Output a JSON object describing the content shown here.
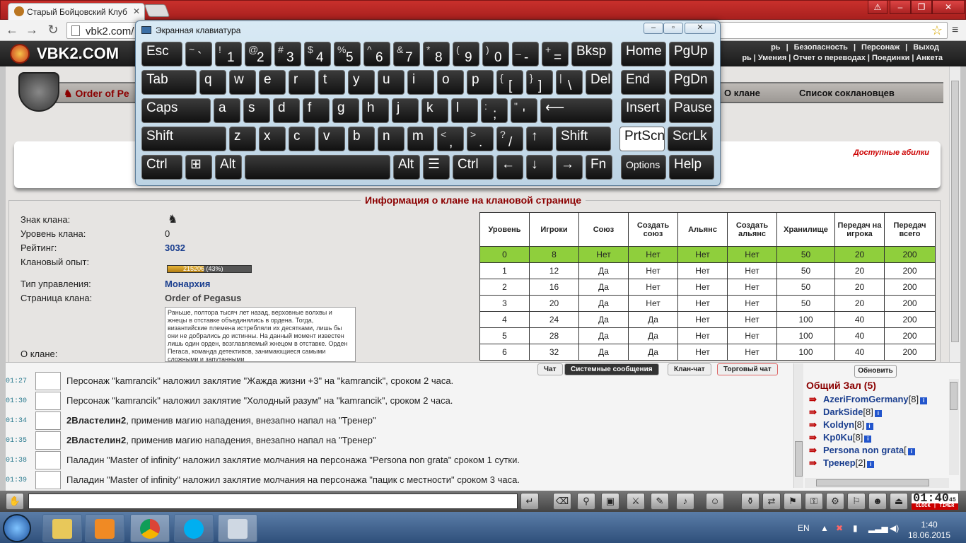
{
  "browser": {
    "tab_title": "Старый Бойцовский Клуб",
    "url": "vbk2.com/",
    "window_controls": [
      "⚠",
      "–",
      "❐",
      "✕"
    ]
  },
  "game": {
    "logo": "VBK2.COM",
    "topnav": [
      "рь",
      "Безопасность",
      "Персонаж",
      "Выход"
    ],
    "subnav": [
      "рь",
      "Умения",
      "Отчет о переводах",
      "Поединки",
      "Анкета"
    ]
  },
  "clan_page": {
    "order_link": "Order of Pe",
    "about_link": "О клане",
    "members_link": "Список соклановцев",
    "abilities_link": "Доступные абилки",
    "info_title": "Информация о клане на клановой странице",
    "fields": {
      "sign_label": "Знак клана:",
      "level_label": "Уровень клана:",
      "level_value": "0",
      "rating_label": "Рейтинг:",
      "rating_value": "3032",
      "xp_label": "Клановый опыт:",
      "xp_value": "215206 (43%)",
      "xp_fraction": 0.43,
      "gov_label": "Тип управления:",
      "gov_value": "Монархия",
      "page_label": "Страница клана:",
      "page_value": "Order of Pegasus",
      "about_label": "О клане:",
      "about_text": "Раньше, полтора тысяч лет назад, верховные волхвы и жнецы в отставке объединялись в ордена. Тогда, византийские племена истребляли их десятками, лишь бы они не добрались до истинны. На данный момент известен лишь один орден, возглавляемый жнецом в отставке. Орден Пегаса, команда детективов, занимающиеся самыми сложными и запутанными"
    },
    "table": {
      "headers": [
        "Уровень",
        "Игроки",
        "Союз",
        "Создать союз",
        "Альянс",
        "Создать альянс",
        "Хранилище",
        "Передач на игрока",
        "Передач всего"
      ],
      "rows": [
        [
          "0",
          "8",
          "Нет",
          "Нет",
          "Нет",
          "Нет",
          "50",
          "20",
          "200"
        ],
        [
          "1",
          "12",
          "Да",
          "Нет",
          "Нет",
          "Нет",
          "50",
          "20",
          "200"
        ],
        [
          "2",
          "16",
          "Да",
          "Нет",
          "Нет",
          "Нет",
          "50",
          "20",
          "200"
        ],
        [
          "3",
          "20",
          "Да",
          "Нет",
          "Нет",
          "Нет",
          "50",
          "20",
          "200"
        ],
        [
          "4",
          "24",
          "Да",
          "Да",
          "Нет",
          "Нет",
          "100",
          "40",
          "200"
        ],
        [
          "5",
          "28",
          "Да",
          "Да",
          "Нет",
          "Нет",
          "100",
          "40",
          "200"
        ],
        [
          "6",
          "32",
          "Да",
          "Да",
          "Нет",
          "Нет",
          "100",
          "40",
          "200"
        ]
      ]
    }
  },
  "chat": {
    "tabs": [
      "Чат",
      "Системные сообщения",
      "Клан-чат",
      "Торговый чат"
    ],
    "messages": [
      {
        "time": "01:27",
        "text": "Персонаж \"kamrancik\" наложил заклятие \"Жажда жизни +3\" на \"kamrancik\", сроком 2 часа."
      },
      {
        "time": "01:30",
        "text": "Персонаж \"kamrancik\" наложил заклятие \"Холодный разум\" на \"kamrancik\", сроком 2 часа."
      },
      {
        "time": "01:34",
        "bold": "2Властелин2",
        "text": ", применив магию нападения, внезапно напал на \"Тренер\""
      },
      {
        "time": "01:35",
        "bold": "2Властелин2",
        "text": ", применив магию нападения, внезапно напал на \"Тренер\""
      },
      {
        "time": "01:38",
        "text": "Паладин \"Master of infinity\" наложил заклятие молчания на персонажа \"Persona non grata\" сроком 1 сутки."
      },
      {
        "time": "01:39",
        "text": "Паладин \"Master of infinity\" наложил заклятие молчания на персонажа \"пацик с местности\" сроком 3 часа."
      }
    ],
    "refresh_label": "Обновить",
    "hall_title": "Общий Зал (5)",
    "users": [
      {
        "name": "AzeriFromGermany",
        "level": "[8]"
      },
      {
        "name": "DarkSide",
        "level": "[8]"
      },
      {
        "name": "Koldyn",
        "level": "[8]"
      },
      {
        "name": "Kp0Ku",
        "level": "[8]"
      },
      {
        "name": "Persona non grata",
        "level": "["
      },
      {
        "name": "Тренер",
        "level": "[2]"
      }
    ]
  },
  "clock": {
    "time": "01:40",
    "sec": "45",
    "label": "CLOCK | TIMER"
  },
  "osk": {
    "title": "Экранная клавиатура",
    "rows": [
      [
        "Esc",
        "~ `",
        "! 1",
        "@ 2",
        "# 3",
        "$ 4",
        "% 5",
        "^ 6",
        "& 7",
        "* 8",
        "( 9",
        ") 0",
        "_ -",
        "+ =",
        "Bksp",
        "Home",
        "PgUp"
      ],
      [
        "Tab",
        "q",
        "w",
        "e",
        "r",
        "t",
        "y",
        "u",
        "i",
        "o",
        "p",
        "{ [",
        "} ]",
        "| \\",
        "Del",
        "End",
        "PgDn"
      ],
      [
        "Caps",
        "a",
        "s",
        "d",
        "f",
        "g",
        "h",
        "j",
        "k",
        "l",
        ": ;",
        "\" '",
        "⟵",
        "Insert",
        "Pause"
      ],
      [
        "Shift",
        "z",
        "x",
        "c",
        "v",
        "b",
        "n",
        "m",
        "< ,",
        "> .",
        "? /",
        "↑",
        "Shift",
        "PrtScn",
        "ScrLk"
      ],
      [
        "Ctrl",
        "⊞",
        "Alt",
        "",
        "Alt",
        "☰",
        "Ctrl",
        "←",
        "↓",
        "→",
        "Fn",
        "Options",
        "Help"
      ]
    ]
  },
  "taskbar": {
    "lang": "EN",
    "time": "1:40",
    "date": "18.06.2015"
  }
}
